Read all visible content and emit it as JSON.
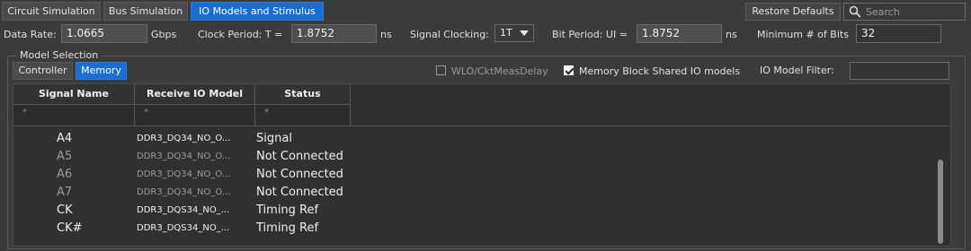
{
  "top_tabs": [
    {
      "label": "Circuit Simulation",
      "active": false
    },
    {
      "label": "Bus Simulation",
      "active": false
    },
    {
      "label": "IO Models and Stimulus",
      "active": true
    }
  ],
  "toolbar": {
    "restore_label": "Restore Defaults",
    "search_placeholder": "Search"
  },
  "params": {
    "data_rate_label": "Data Rate:",
    "data_rate_value": "1.0665",
    "data_rate_unit": "Gbps",
    "clock_period_label": "Clock Period: T =",
    "clock_period_value": "1.8752",
    "clock_period_unit": "ns",
    "signal_clocking_label": "Signal Clocking:",
    "signal_clocking_value": "1T",
    "bit_period_label": "Bit Period: UI =",
    "bit_period_value": "1.8752",
    "bit_period_unit": "ns",
    "min_bits_label": "Minimum # of Bits",
    "min_bits_value": "32"
  },
  "model_selection": {
    "title": "Model Selection",
    "sub_tabs": [
      {
        "label": "Controller",
        "active": false
      },
      {
        "label": "Memory",
        "active": true
      }
    ],
    "wlo_label": "WLO/CktMeasDelay",
    "wlo_checked": false,
    "shared_label": "Memory Block Shared IO models",
    "shared_checked": true,
    "filter_label": "IO Model Filter:",
    "filter_value": ""
  },
  "table": {
    "columns": [
      "Signal Name",
      "Receive IO Model",
      "Status"
    ],
    "filters": [
      "*",
      "*",
      "*"
    ],
    "rows": [
      {
        "name": "A4",
        "model": "DDR3_DQ34_NO_O...",
        "status": "Signal",
        "dim": false
      },
      {
        "name": "A5",
        "model": "DDR3_DQ34_NO_O...",
        "status": "Not Connected",
        "dim": true
      },
      {
        "name": "A6",
        "model": "DDR3_DQ34_NO_O...",
        "status": "Not Connected",
        "dim": true
      },
      {
        "name": "A7",
        "model": "DDR3_DQ34_NO_O...",
        "status": "Not Connected",
        "dim": true
      },
      {
        "name": "CK",
        "model": "DDR3_DQS34_NO_...",
        "status": "Timing Ref",
        "dim": false
      },
      {
        "name": "CK#",
        "model": "DDR3_DQS34_NO_...",
        "status": "Timing Ref",
        "dim": false
      }
    ]
  },
  "icons": {
    "search": "magnifier-icon",
    "dropdown": "chevron-down-icon"
  },
  "colors": {
    "accent": "#1b6ecf",
    "background": "#3b3b3b"
  }
}
